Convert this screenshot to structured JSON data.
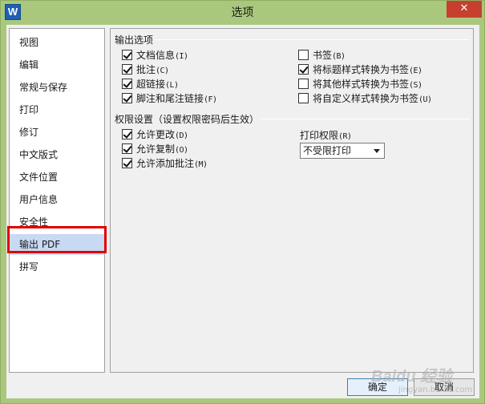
{
  "window": {
    "title": "选项",
    "app_icon_letter": "W",
    "close_glyph": "✕"
  },
  "sidebar": {
    "items": [
      {
        "label": "视图"
      },
      {
        "label": "编辑"
      },
      {
        "label": "常规与保存"
      },
      {
        "label": "打印"
      },
      {
        "label": "修订"
      },
      {
        "label": "中文版式"
      },
      {
        "label": "文件位置"
      },
      {
        "label": "用户信息"
      },
      {
        "label": "安全性"
      },
      {
        "label": "输出 PDF",
        "selected": true
      },
      {
        "label": "拼写"
      }
    ]
  },
  "output_group": {
    "title": "输出选项",
    "left": [
      {
        "label": "文档信息",
        "accel": "(I)",
        "checked": true
      },
      {
        "label": "批注",
        "accel": "(C)",
        "checked": true
      },
      {
        "label": "超链接",
        "accel": "(L)",
        "checked": true
      },
      {
        "label": "脚注和尾注链接",
        "accel": "(F)",
        "checked": true
      }
    ],
    "right": [
      {
        "label": "书签",
        "accel": "(B)",
        "checked": false
      },
      {
        "label": "将标题样式转换为书签",
        "accel": "(E)",
        "checked": true
      },
      {
        "label": "将其他样式转换为书签",
        "accel": "(S)",
        "checked": false
      },
      {
        "label": "将自定义样式转换为书签",
        "accel": "(U)",
        "checked": false
      }
    ]
  },
  "permission_group": {
    "title": "权限设置（设置权限密码后生效）",
    "items": [
      {
        "label": "允许更改",
        "accel": "(D)",
        "checked": true
      },
      {
        "label": "允许复制",
        "accel": "(O)",
        "checked": true
      },
      {
        "label": "允许添加批注",
        "accel": "(M)",
        "checked": true
      }
    ],
    "print_label": "打印权限",
    "print_accel": "(R)",
    "print_value": "不受限打印"
  },
  "buttons": {
    "ok": "确定",
    "cancel": "取消"
  },
  "watermark": {
    "main": "Baidu 经验",
    "sub": "jingyan.baidu.com"
  }
}
